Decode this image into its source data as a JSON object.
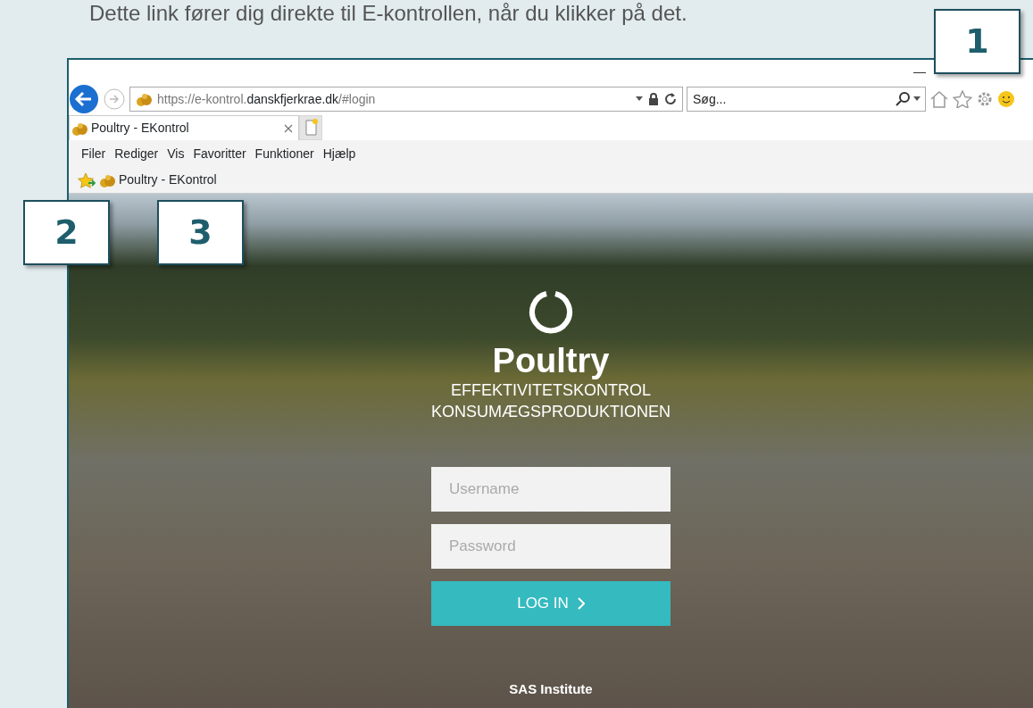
{
  "caption": "Dette link fører dig direkte til E-kontrollen, når du klikker på det.",
  "callouts": [
    {
      "number": "1"
    },
    {
      "number": "2"
    },
    {
      "number": "3"
    }
  ],
  "browser": {
    "url": {
      "prefix": "https://e-kontrol.",
      "domain": "danskfjerkrae.dk",
      "suffix": "/#login"
    },
    "search": {
      "placeholder": "Søg..."
    },
    "tabs": [
      {
        "label": "Poultry - EKontrol",
        "selected": true
      }
    ],
    "menu": [
      "Filer",
      "Rediger",
      "Vis",
      "Favoritter",
      "Funktioner",
      "Hjælp"
    ],
    "favorites": [
      {
        "label": "Poultry - EKontrol"
      }
    ]
  },
  "login": {
    "title": "Poultry",
    "subtitle": [
      "EFFEKTIVITETSKONTROL",
      "KONSUMÆGSPRODUKTIONEN"
    ],
    "username": {
      "placeholder": "Username"
    },
    "password": {
      "placeholder": "Password"
    },
    "button": "LOG IN",
    "footer": "SAS Institute"
  }
}
